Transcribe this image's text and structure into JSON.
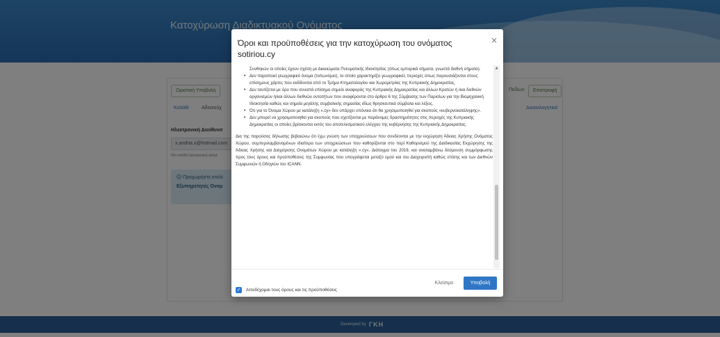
{
  "page": {
    "hero_title": "Κατοχύρωση Διαδικτυακού Ονόματος",
    "tabs": [
      "Οριστική Υποβολή",
      "Πεδίων",
      "Επιστροφή"
    ],
    "links": [
      "Καλάθι",
      "Αδεισούχ",
      "Δικαιολογητικά"
    ],
    "email_label": "Ηλεκτρονική Διεύθυνσ",
    "email_value": "x.andria.x@hotmail.com",
    "email_help": "Θα σταλθεί ηλεκτρονική αλληλ",
    "alert_line1": "Προχωρήστε επιλέ",
    "alert_line2": "Εξυπηρετητές Ονομ",
    "footer_text": "Developed by",
    "footer_logo": "ΓΚΗ"
  },
  "modal": {
    "title": "Όροι και προϋποθέσεις για την κατοχύρωση του ονόματος sotiriou.cy",
    "close_glyph": "×",
    "terms": {
      "top_fragment": "Συνθηκών οι οποίες έχουν σχέση με Δικαιώματα Πνευματικής Ιδιοκτησίας (όπως εμπορικά σήματα, γνωστά διεθνή σήματα).",
      "bullets": [
        "Δεν παραποιεί γεωγραφικό όνομα (τοπωνύμιο), το οποίο χαρακτηρίζει γεωγραφικές περιοχές όπως παρουσιάζονται στους επίσημους χάρτες που εκδίδονται από το Τμήμα Κτηματολογίου και Χωρομετρίας της Κυπριακής Δημοκρατίας.",
        "Δεν ταυτίζεται με όρο που συνιστά επίσημο σημείο αναφοράς της Κυπριακής Δημοκρατίας και άλλων Κρατών ή /και διεθνών οργανισμών ή/και άλλων διεθνών οντοτήτων που αναφέρονται στο άρθρο 6 της Σύμβασης των Παρισίων για την Βιομηχανική Ιδιοκτησία καθώς και σημεία μεγάλης συμβολικής σημασίας ιδίως θρησκευτικά σύμβολα και λέξεις.",
        "Ότι για το Όνομα Χώρου με κατάληξη «.cy» δεν υπάρχει υπόνοια ότι θα χρησιμοποιηθεί για σκοπούς «κυβερνοκατάληψης».",
        "Δεν μπορεί να χρησιμοποιηθεί για σκοπούς που σχετίζονται με παράνομες δραστηριότητες στις περιοχές της Κυπριακής Δημοκρατίας οι οποίες βρίσκονται εκτός του αποτελεσματικού ελέγχου της κυβέρνησης της Κυπριακής Δημοκρατίας."
      ],
      "declaration": "Δια της παρούσας δήλωσης βεβαιώνω ότι έχω γνώση των υποχρεώσεων που συνδέονται με την εκχώρηση Άδειας Χρήσης Ονόματος Χώρου, συμπεριλαμβανομένων ιδιαίτερα των υποχρεώσεων που καθορίζονται στο περί Καθορισμού της Διαδικασίας Εκχώρησης της Άδειας Χρήσης και Διαχείρισης Ονομάτων Χώρου με κατάληξη «.cy». Διάταγμα του 2019, και αναλαμβάνω δέσμευση συμμόρφωσης προς τους όρους και προϋποθέσεις της Συμφωνίας που υπογράφεται μεταξύ εμού και του Διαχειριστή καθώς επίσης και των Διεθνών Συμφωνιών ή Οδηγιών του ICANN."
    },
    "accept_label": "Αποδέχομαι τους όρους και τις προϋποθέσεις",
    "accept_checked": true,
    "close_button": "Κλείσιμο",
    "submit_button": "Υποβολή"
  },
  "colors": {
    "primary": "#2f77c6",
    "header_blue": "#2a6cb0",
    "footer_blue": "#2a5f9a",
    "logo_accent": "#e35b3a"
  }
}
